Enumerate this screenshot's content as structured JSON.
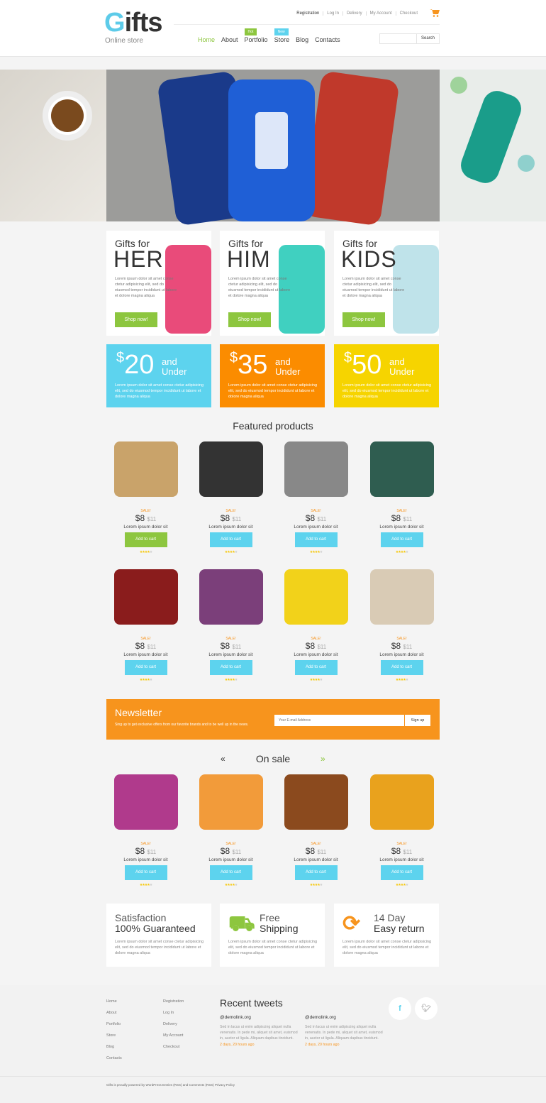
{
  "header": {
    "logo": "Gifts",
    "logo_g": "G",
    "logo_rest": "ifts",
    "tagline": "Online store",
    "top_links": [
      "Registration",
      "Log In",
      "Delivery",
      "My Account",
      "Checkout"
    ],
    "nav": [
      {
        "label": "Home",
        "active": true
      },
      {
        "label": "About"
      },
      {
        "label": "Portfolio",
        "badge": "Hot",
        "badge_color": "#8dc63f"
      },
      {
        "label": "Store",
        "badge": "New",
        "badge_color": "#5dd3ee"
      },
      {
        "label": "Blog"
      },
      {
        "label": "Contacts"
      }
    ],
    "search_button": "Search",
    "search_value": ""
  },
  "categories": [
    {
      "line1": "Gifts for",
      "line2": "HER",
      "text": "Lorem ipsum dolor sit amet conse ctetur adipisicing elit, sed do eiusmod tempor incididunt ut labore et dolore magna aliqua",
      "button": "Shop now!"
    },
    {
      "line1": "Gifts for",
      "line2": "HIM",
      "text": "Lorem ipsum dolor sit amet conse ctetur adipisicing elit, sed do eiusmod tempor incididunt ut labore et dolore magna aliqua",
      "button": "Shop now!"
    },
    {
      "line1": "Gifts for",
      "line2": "KIDS",
      "text": "Lorem ipsum dolor sit amet conse ctetur adipisicing elit, sed do eiusmod tempor incididunt ut labore et dolore magna aliqua",
      "button": "Shop now!"
    }
  ],
  "price_tiers": [
    {
      "currency": "$",
      "amount": "20",
      "and": "and",
      "under": "Under",
      "text": "Lorem ipsum dolor sit amet conse ctetur adipisicing elit, sed do eiusmod tempor incididunt ut labore et dolore magna aliqua",
      "color": "#5dd3ee"
    },
    {
      "currency": "$",
      "amount": "35",
      "and": "and",
      "under": "Under",
      "text": "Lorem ipsum dolor sit amet conse ctetur adipisicing elit, sed do eiusmod tempor incididunt ut labore et dolore magna aliqua",
      "color": "#fb8c00"
    },
    {
      "currency": "$",
      "amount": "50",
      "and": "and",
      "under": "Under",
      "text": "Lorem ipsum dolor sit amet conse ctetur adipisicing elit, sed do eiusmod tempor incididunt ut labore et dolore magna aliqua",
      "color": "#f6d400"
    }
  ],
  "featured": {
    "title": "Featured products",
    "products": [
      {
        "sale": "SALE!",
        "price": "$8",
        "old": "$11",
        "name": "Lorem ipsum dolor sit",
        "button": "Add to cart",
        "rating": 4,
        "highlight": true,
        "color": "#c9a36a"
      },
      {
        "sale": "SALE!",
        "price": "$8",
        "old": "$11",
        "name": "Lorem ipsum dolor sit",
        "button": "Add to cart",
        "rating": 4,
        "color": "#333"
      },
      {
        "sale": "SALE!",
        "price": "$8",
        "old": "$11",
        "name": "Lorem ipsum dolor sit",
        "button": "Add to cart",
        "rating": 4,
        "color": "#888"
      },
      {
        "sale": "SALE!",
        "price": "$8",
        "old": "$11",
        "name": "Lorem ipsum dolor sit",
        "button": "Add to cart",
        "rating": 4,
        "color": "#2f5d50"
      },
      {
        "sale": "SALE!",
        "price": "$8",
        "old": "$11",
        "name": "Lorem ipsum dolor sit",
        "button": "Add to cart",
        "rating": 4,
        "color": "#8a1c1c"
      },
      {
        "sale": "SALE!",
        "price": "$8",
        "old": "$11",
        "name": "Lorem ipsum dolor sit",
        "button": "Add to cart",
        "rating": 4,
        "color": "#7b3f7a"
      },
      {
        "sale": "SALE!",
        "price": "$8",
        "old": "$11",
        "name": "Lorem ipsum dolor sit",
        "button": "Add to cart",
        "rating": 4,
        "color": "#f2d21a"
      },
      {
        "sale": "SALE!",
        "price": "$8",
        "old": "$11",
        "name": "Lorem ipsum dolor sit",
        "button": "Add to cart",
        "rating": 4,
        "color": "#d9cbb5"
      }
    ]
  },
  "newsletter": {
    "title": "Newsletter",
    "text": "Sing up to get exclusive offers from our favorite brands and to be well up in the news.",
    "placeholder": "Your E-mail Address",
    "button": "Sign up"
  },
  "on_sale": {
    "title": "On sale",
    "prev": "«",
    "next": "»",
    "products": [
      {
        "sale": "SALE!",
        "price": "$8",
        "old": "$11",
        "name": "Lorem ipsum dolor sit",
        "button": "Add to cart",
        "rating": 4,
        "color": "#b03a8c"
      },
      {
        "sale": "SALE!",
        "price": "$8",
        "old": "$11",
        "name": "Lorem ipsum dolor sit",
        "button": "Add to cart",
        "rating": 4,
        "color": "#f29b3a"
      },
      {
        "sale": "SALE!",
        "price": "$8",
        "old": "$11",
        "name": "Lorem ipsum dolor sit",
        "button": "Add to cart",
        "rating": 4,
        "color": "#8b4a1e"
      },
      {
        "sale": "SALE!",
        "price": "$8",
        "old": "$11",
        "name": "Lorem ipsum dolor sit",
        "button": "Add to cart",
        "rating": 4,
        "color": "#e9a21d"
      }
    ]
  },
  "features": [
    {
      "line1": "Satisfaction",
      "line2": "100% Guaranteed",
      "icon": "none",
      "text": "Lorem ipsum dolor sit amet conse ctetur adipisicing elit, sed do eiusmod tempor incididunt ut labore et dolore magna aliqua"
    },
    {
      "line1": "Free",
      "line2": "Shipping",
      "icon": "truck-icon",
      "icon_color": "#8dc63f",
      "text": "Lorem ipsum dolor sit amet conse ctetur adipisicing elit, sed do eiusmod tempor incididunt ut labore et dolore magna aliqua"
    },
    {
      "line1": "14 Day",
      "line2": "Easy return",
      "icon": "refresh-icon",
      "icon_color": "#f7941d",
      "text": "Lorem ipsum dolor sit amet conse ctetur adipisicing elit, sed do eiusmod tempor incididunt ut labore et dolore magna aliqua"
    }
  ],
  "footer": {
    "col1": [
      "Home",
      "About",
      "Portfolio",
      "Store",
      "Blog",
      "Contacts"
    ],
    "col2": [
      "Registration",
      "Log In",
      "Delivery",
      "My Account",
      "Checkout"
    ],
    "tweets_title": "Recent tweets",
    "tweets": [
      {
        "handle": "@demolink.org",
        "text": "Sed in lacus ut enim adipiscing aliquet nulla venenatis. In pede mi, aliquet sit amet, euismod in, auctor ut ligula. Aliquam dapibus tincidunt.",
        "time": "2 days, 20 hours ago"
      },
      {
        "handle": "@demolink.org",
        "text": "Sed in lacus ut enim adipiscing aliquet nulla venenatis. In pede mi, aliquet sit amet, euismod in, auctor ut ligula. Aliquam dapibus tincidunt.",
        "time": "2 days, 20 hours ago"
      }
    ],
    "social": [
      {
        "icon": "facebook-icon",
        "glyph": "f",
        "color": "#5dd3ee"
      },
      {
        "icon": "twitter-icon",
        "glyph": "t",
        "color": "#bbb"
      }
    ],
    "copyright": "Gifts is proudly powered by WordPress Entries (RSS) and Comments (RSS) Privacy Policy"
  }
}
